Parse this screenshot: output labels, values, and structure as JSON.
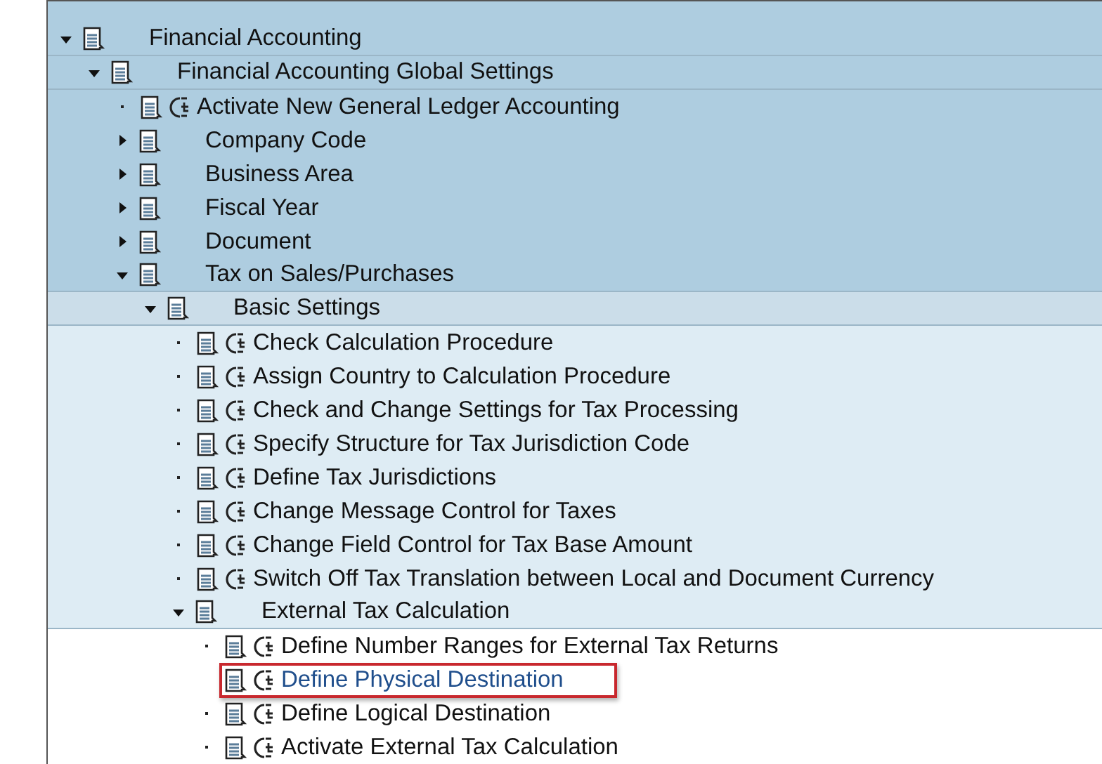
{
  "tree": [
    {
      "kind": "node",
      "label": "Financial Accounting",
      "expanded": true,
      "children": [
        {
          "kind": "node",
          "label": "Financial Accounting Global Settings",
          "expanded": true,
          "children": [
            {
              "kind": "activity",
              "label": "Activate New General Ledger Accounting",
              "selected": false
            },
            {
              "kind": "node",
              "label": "Company Code",
              "expanded": false
            },
            {
              "kind": "node",
              "label": "Business Area",
              "expanded": false
            },
            {
              "kind": "node",
              "label": "Fiscal Year",
              "expanded": false
            },
            {
              "kind": "node",
              "label": "Document",
              "expanded": false
            },
            {
              "kind": "node",
              "label": "Tax on Sales/Purchases",
              "expanded": true,
              "children": [
                {
                  "kind": "node",
                  "label": "Basic Settings",
                  "expanded": true,
                  "children": [
                    {
                      "kind": "activity",
                      "label": "Check Calculation Procedure",
                      "selected": false
                    },
                    {
                      "kind": "activity",
                      "label": "Assign Country to Calculation Procedure",
                      "selected": false
                    },
                    {
                      "kind": "activity",
                      "label": "Check and Change Settings for Tax Processing",
                      "selected": false
                    },
                    {
                      "kind": "activity",
                      "label": "Specify Structure for Tax Jurisdiction Code",
                      "selected": false
                    },
                    {
                      "kind": "activity",
                      "label": "Define Tax Jurisdictions",
                      "selected": false
                    },
                    {
                      "kind": "activity",
                      "label": "Change Message Control for Taxes",
                      "selected": false
                    },
                    {
                      "kind": "activity",
                      "label": "Change Field Control for Tax Base Amount",
                      "selected": false
                    },
                    {
                      "kind": "activity",
                      "label": "Switch Off Tax Translation between Local and Document Currency",
                      "selected": false
                    },
                    {
                      "kind": "node",
                      "label": "External Tax Calculation",
                      "expanded": true,
                      "children": [
                        {
                          "kind": "activity",
                          "label": "Define Number Ranges for External Tax Returns",
                          "selected": false
                        },
                        {
                          "kind": "activity",
                          "label": "Define Physical Destination",
                          "selected": true
                        },
                        {
                          "kind": "activity",
                          "label": "Define Logical Destination",
                          "selected": false
                        },
                        {
                          "kind": "activity",
                          "label": "Activate External Tax Calculation",
                          "selected": false
                        }
                      ]
                    }
                  ]
                }
              ]
            }
          ]
        }
      ]
    }
  ]
}
